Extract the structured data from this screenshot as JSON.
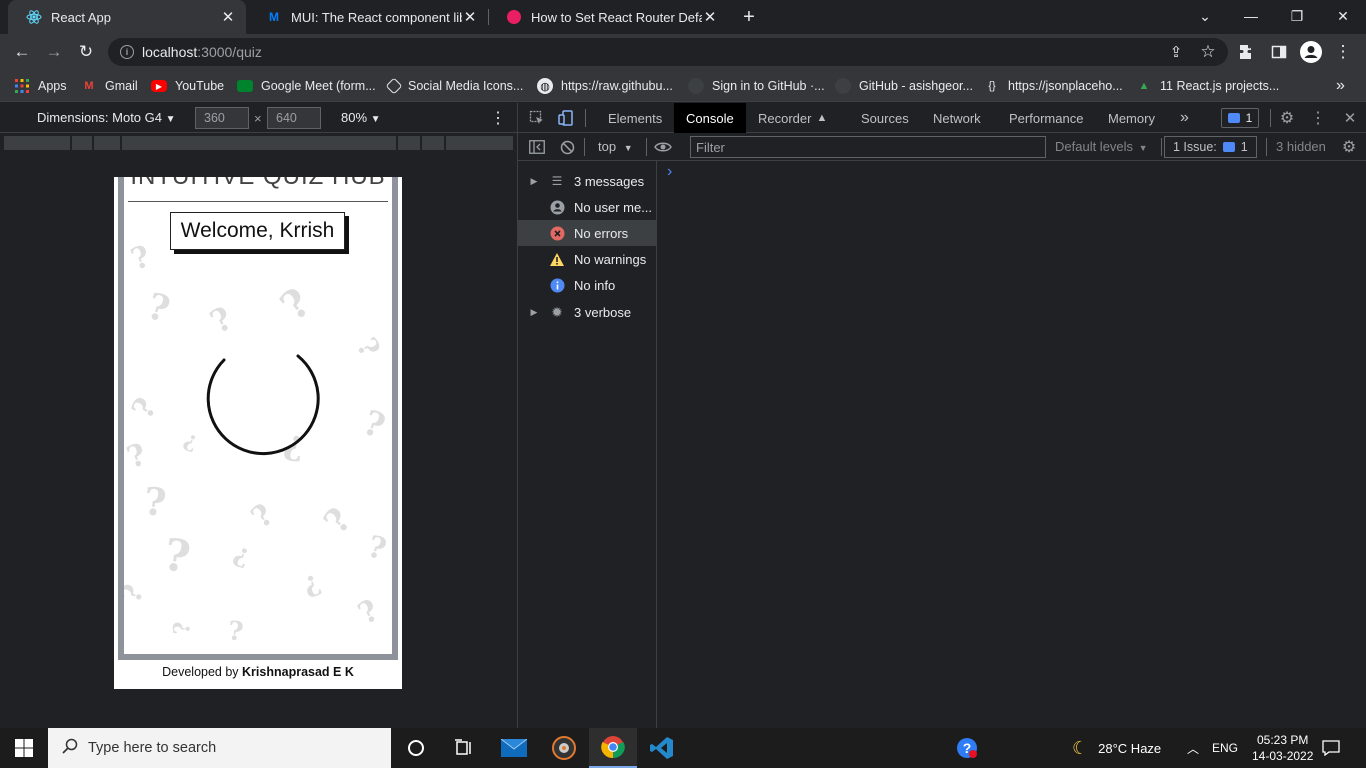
{
  "browser": {
    "tabs": [
      {
        "title": "React App",
        "active": true
      },
      {
        "title": "MUI: The React component librar",
        "active": false
      },
      {
        "title": "How to Set React Router Default",
        "active": false
      }
    ],
    "new_tab_label": "+",
    "url_host": "localhost",
    "url_path": ":3000/quiz",
    "bookmarks": [
      {
        "label": "Apps",
        "icon": "apps-grid-icon"
      },
      {
        "label": "Gmail",
        "icon": "gmail-icon"
      },
      {
        "label": "YouTube",
        "icon": "youtube-icon"
      },
      {
        "label": "Google Meet (form...",
        "icon": "meet-icon"
      },
      {
        "label": "Social Media Icons...",
        "icon": "social-icon"
      },
      {
        "label": "https://raw.githubu...",
        "icon": "globe-icon"
      },
      {
        "label": "Sign in to GitHub ·...",
        "icon": "github-icon"
      },
      {
        "label": "GitHub - asishgeor...",
        "icon": "github-icon"
      },
      {
        "label": "https://jsonplaceho...",
        "icon": "bracket-icon"
      },
      {
        "label": "11 React.js projects...",
        "icon": "cap-icon"
      }
    ]
  },
  "device_toolbar": {
    "dimensions_label": "Dimensions: Moto G4",
    "width": "360",
    "height": "640",
    "times": "×",
    "zoom": "80%"
  },
  "page": {
    "hub_title": "INTUITIVE QUIZ HUB",
    "welcome": "Welcome, Krrish",
    "footer_prefix": "Developed by ",
    "footer_author": "Krishnaprasad E K"
  },
  "devtools": {
    "tabs": [
      "Elements",
      "Console",
      "Recorder",
      "Sources",
      "Network",
      "Performance",
      "Memory"
    ],
    "active_tab": "Console",
    "more_tabs": "»",
    "issue_count": "1",
    "context": "top",
    "filter_placeholder": "Filter",
    "default_levels": "Default levels",
    "issues_label": "1 Issue:",
    "issues_count": "1",
    "hidden": "3 hidden",
    "prompt": "›",
    "sidebar": [
      {
        "label": "3 messages",
        "expandable": true
      },
      {
        "label": "No user me...",
        "expandable": false
      },
      {
        "label": "No errors",
        "expandable": false
      },
      {
        "label": "No warnings",
        "expandable": false
      },
      {
        "label": "No info",
        "expandable": false
      },
      {
        "label": "3 verbose",
        "expandable": true
      }
    ]
  },
  "taskbar": {
    "search_placeholder": "Type here to search",
    "weather": "28°C  Haze",
    "lang": "ENG",
    "time": "05:23 PM",
    "date": "14-03-2022"
  },
  "colors": {
    "accent_blue": "#4e89f5",
    "devtools_bg": "#202124",
    "error_red": "#f28b82",
    "warning_yellow": "#fdd663"
  }
}
